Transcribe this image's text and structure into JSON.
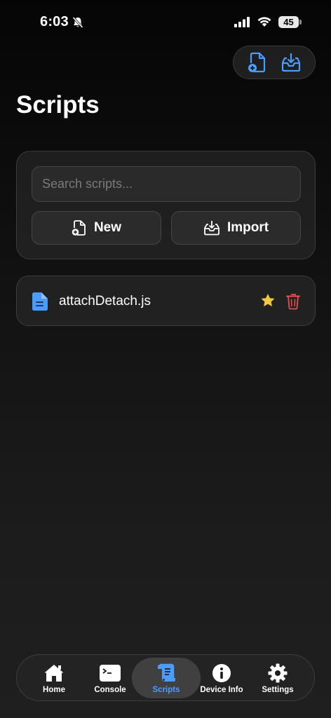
{
  "status_bar": {
    "time": "6:03",
    "battery": "45"
  },
  "top_actions": {
    "new_icon": "file-plus-icon",
    "import_icon": "tray-download-icon"
  },
  "page": {
    "title": "Scripts"
  },
  "search": {
    "placeholder": "Search scripts..."
  },
  "actions": {
    "new_label": "New",
    "import_label": "Import"
  },
  "scripts": [
    {
      "name": "attachDetach.js",
      "favorite": true
    }
  ],
  "tabs": [
    {
      "label": "Home",
      "icon": "house-icon",
      "active": false
    },
    {
      "label": "Console",
      "icon": "terminal-icon",
      "active": false
    },
    {
      "label": "Scripts",
      "icon": "scroll-icon",
      "active": true
    },
    {
      "label": "Device Info",
      "icon": "info-icon",
      "active": false
    },
    {
      "label": "Settings",
      "icon": "gear-icon",
      "active": false
    }
  ],
  "colors": {
    "accent": "#4a9dff",
    "favorite": "#f5c842",
    "delete": "#e0524f",
    "background": "#121212"
  }
}
